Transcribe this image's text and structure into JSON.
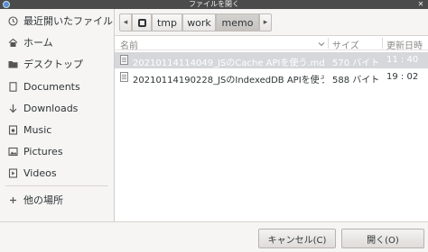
{
  "window": {
    "title": "ファイルを開く",
    "close_glyph": "✕"
  },
  "sidebar": {
    "items": [
      {
        "label": "最近開いたファイル",
        "icon": "clock-icon"
      },
      {
        "label": "ホーム",
        "icon": "home-icon"
      },
      {
        "label": "デスクトップ",
        "icon": "folder-icon"
      },
      {
        "label": "Documents",
        "icon": "document-icon"
      },
      {
        "label": "Downloads",
        "icon": "download-icon"
      },
      {
        "label": "Music",
        "icon": "music-icon"
      },
      {
        "label": "Pictures",
        "icon": "picture-icon"
      },
      {
        "label": "Videos",
        "icon": "video-icon"
      },
      {
        "label": "他の場所",
        "icon": "plus-icon"
      }
    ]
  },
  "pathbar": {
    "back_glyph": "◂",
    "forward_glyph": "▸",
    "crumbs": [
      "tmp",
      "work",
      "memo"
    ],
    "active": "memo"
  },
  "file_list": {
    "columns": {
      "name": "名前",
      "size": "サイズ",
      "modified": "更新日時"
    },
    "rows": [
      {
        "name": "20210114114049_JSのCache APIを使う.md",
        "size": "570 バイト",
        "modified": "11 : 40",
        "selected": true
      },
      {
        "name": "20210114190228_JSのIndexedDB APIを使う...",
        "size": "588 バイト",
        "modified": "19 : 02",
        "selected": false
      }
    ]
  },
  "footer": {
    "cancel_label": "キャンセル(C)",
    "open_label": "開く(O)"
  }
}
